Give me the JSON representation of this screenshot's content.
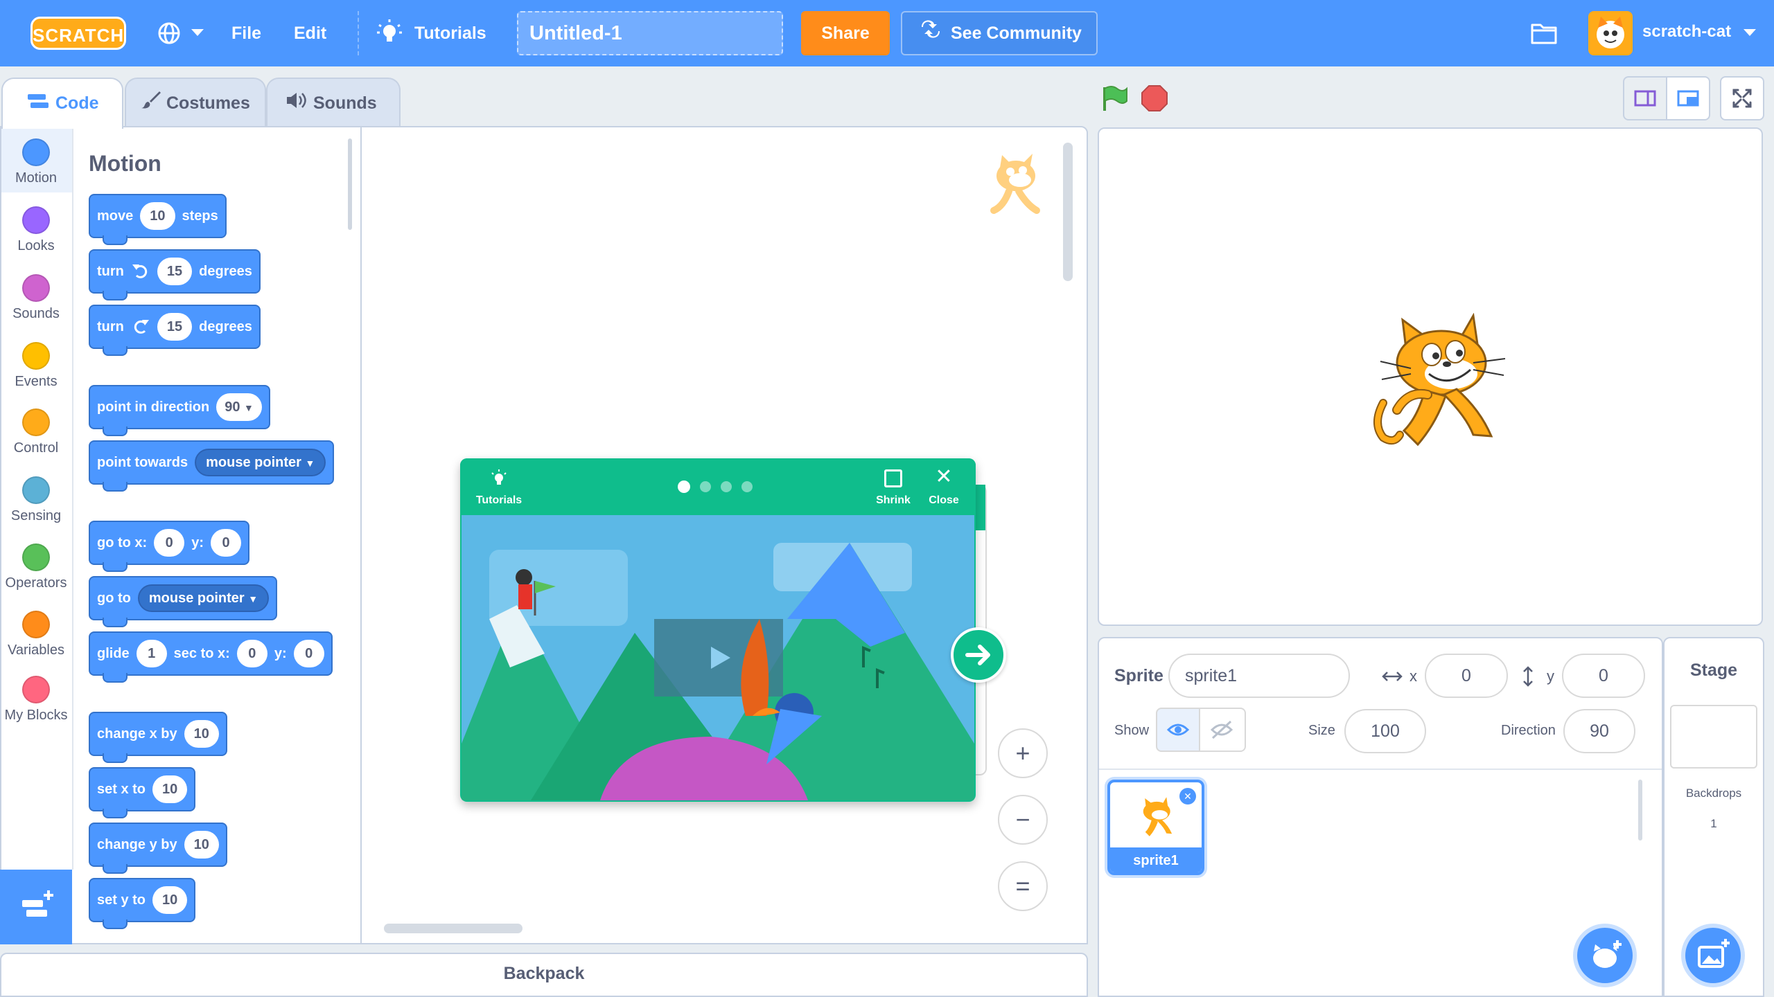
{
  "menubar": {
    "logo_text": "SCRATCH",
    "globe_icon": "globe-icon",
    "file_label": "File",
    "edit_label": "Edit",
    "tutorials_label": "Tutorials",
    "project_title": "Untitled-1",
    "share_label": "Share",
    "community_label": "See Community",
    "username": "scratch-cat"
  },
  "tabs": [
    {
      "label": "Code"
    },
    {
      "label": "Costumes"
    },
    {
      "label": "Sounds"
    }
  ],
  "categories": [
    {
      "label": "Motion",
      "color": "#4c97ff"
    },
    {
      "label": "Looks",
      "color": "#9966ff"
    },
    {
      "label": "Sounds",
      "color": "#cf63cf"
    },
    {
      "label": "Events",
      "color": "#ffbf00"
    },
    {
      "label": "Control",
      "color": "#ffab19"
    },
    {
      "label": "Sensing",
      "color": "#5cb1d6"
    },
    {
      "label": "Operators",
      "color": "#59c059"
    },
    {
      "label": "Variables",
      "color": "#ff8c1a"
    },
    {
      "label": "My Blocks",
      "color": "#ff6680"
    }
  ],
  "palette": {
    "heading": "Motion",
    "move": {
      "a": "move",
      "v": "10",
      "b": "steps"
    },
    "turn_left": {
      "a": "turn",
      "v": "15",
      "b": "degrees"
    },
    "turn_right": {
      "a": "turn",
      "v": "15",
      "b": "degrees"
    },
    "point_dir": {
      "a": "point in direction",
      "v": "90"
    },
    "point_towards": {
      "a": "point towards",
      "v": "mouse pointer"
    },
    "goto_xy": {
      "a": "go to x:",
      "x": "0",
      "b": "y:",
      "y": "0"
    },
    "goto": {
      "a": "go to",
      "v": "mouse pointer"
    },
    "glide": {
      "a": "glide",
      "s": "1",
      "b": "sec to x:",
      "x": "0",
      "c": "y:",
      "y": "0"
    },
    "change_x": {
      "a": "change x by",
      "v": "10"
    },
    "set_x": {
      "a": "set x to",
      "v": "10"
    },
    "change_y": {
      "a": "change y by",
      "v": "10"
    },
    "set_y": {
      "a": "set y to",
      "v": "10"
    }
  },
  "tutorial_card": {
    "tutorials_label": "Tutorials",
    "shrink_label": "Shrink",
    "close_label": "Close",
    "step_count": 4,
    "active_step": 1
  },
  "workspace": {
    "zoom_in": "+",
    "zoom_out": "−",
    "zoom_reset": "="
  },
  "backpack_label": "Backpack",
  "sprite_info": {
    "sprite_label": "Sprite",
    "sprite_name": "sprite1",
    "x_label": "x",
    "x_value": "0",
    "y_label": "y",
    "y_value": "0",
    "show_label": "Show",
    "size_label": "Size",
    "size_value": "100",
    "direction_label": "Direction",
    "direction_value": "90"
  },
  "sprites": [
    {
      "name": "sprite1"
    }
  ],
  "stage_panel": {
    "title": "Stage",
    "backdrops_label": "Backdrops",
    "backdrops_count": "1"
  },
  "colors": {
    "menu_blue": "#4c97ff",
    "share_orange": "#ff8c1a",
    "tutorial_green": "#0fbd8c",
    "motion_blue": "#4c97ff"
  }
}
